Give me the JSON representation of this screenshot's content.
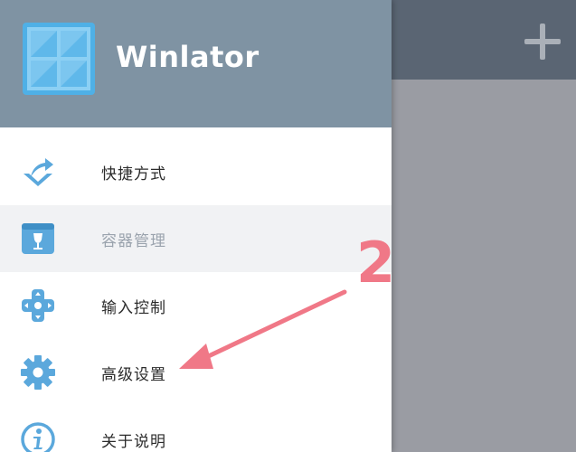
{
  "app": {
    "title": "Winlator"
  },
  "toolbar": {
    "add_icon": "plus-icon"
  },
  "menu": {
    "items": [
      {
        "label": "快捷方式",
        "icon": "shortcut-arrow-icon",
        "selected": false
      },
      {
        "label": "容器管理",
        "icon": "container-box-icon",
        "selected": true
      },
      {
        "label": "输入控制",
        "icon": "dpad-icon",
        "selected": false
      },
      {
        "label": "高级设置",
        "icon": "gear-icon",
        "selected": false
      },
      {
        "label": "关于说明",
        "icon": "info-icon",
        "selected": false
      }
    ]
  },
  "annotation": {
    "number": "2"
  },
  "colors": {
    "header": "#7f93a3",
    "icon_blue": "#5ba8dc",
    "annotation": "#f07887",
    "scrim": "#9a9ca3"
  }
}
